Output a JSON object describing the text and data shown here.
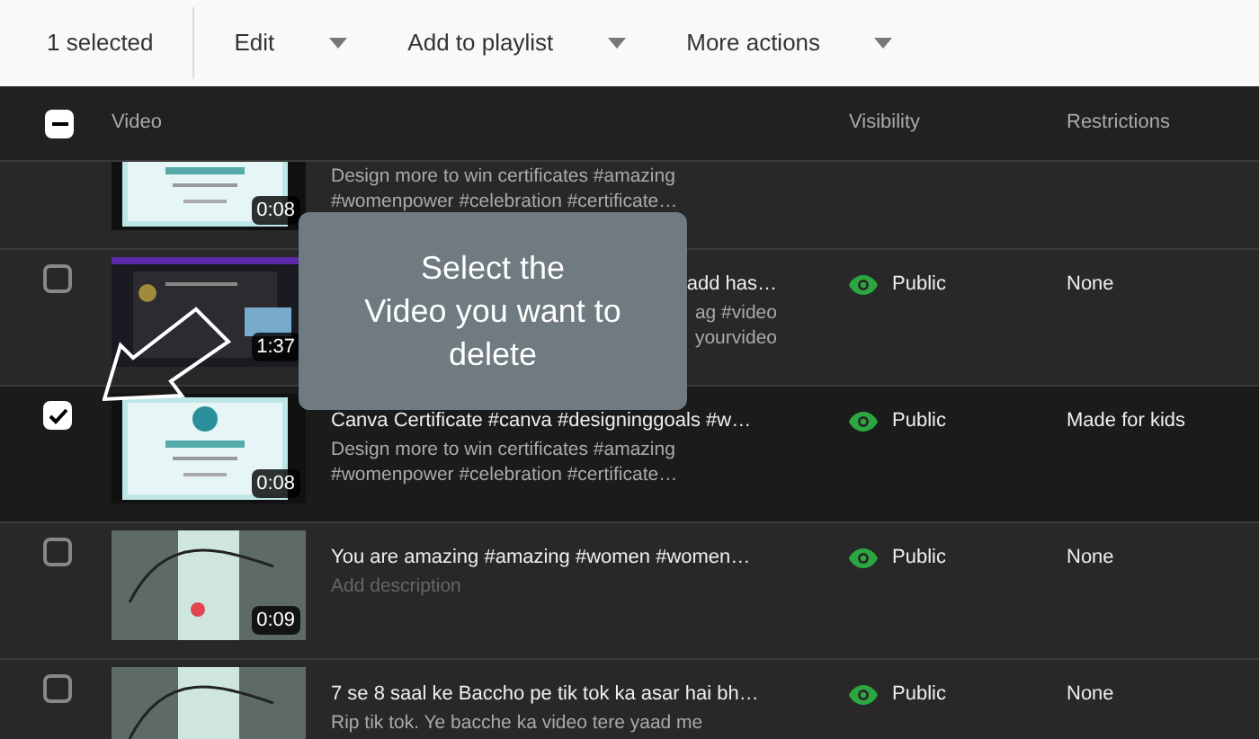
{
  "toolbar": {
    "selection_count": "1 selected",
    "actions": [
      {
        "label": "Edit"
      },
      {
        "label": "Add to playlist"
      },
      {
        "label": "More actions"
      }
    ]
  },
  "table": {
    "select_all": {
      "indeterminate": true
    },
    "columns": [
      "Video",
      "Visibility",
      "Restrictions"
    ],
    "partial_row": {
      "duration": "0:08",
      "description": [
        "Design more to win certificates #amazing",
        "#womenpower #celebration #certificate…"
      ]
    },
    "rows": [
      {
        "selected": false,
        "covered": true,
        "duration": "1:37",
        "title": "add has…",
        "description": [
          "ag #video",
          "yourvideo"
        ],
        "visibility": "Public",
        "restrictions": "None"
      },
      {
        "selected": true,
        "duration": "0:08",
        "title": "Canva Certificate #canva #designinggoals #w…",
        "description": [
          "Design more to win certificates #amazing",
          "#womenpower #celebration #certificate…"
        ],
        "visibility": "Public",
        "restrictions": "Made for kids"
      },
      {
        "selected": false,
        "duration": "0:09",
        "title": "You are amazing #amazing #women #women…",
        "placeholder": "Add description",
        "visibility": "Public",
        "restrictions": "None"
      },
      {
        "selected": false,
        "title": "7 se 8 saal ke Baccho pe tik tok ka asar hai bh…",
        "description": [
          "Rip tik tok. Ye bacche ka video tere yaad me"
        ],
        "visibility": "Public",
        "restrictions": "None"
      }
    ]
  },
  "callout": {
    "lines": [
      "Select the",
      "Video you want to",
      "delete"
    ]
  }
}
